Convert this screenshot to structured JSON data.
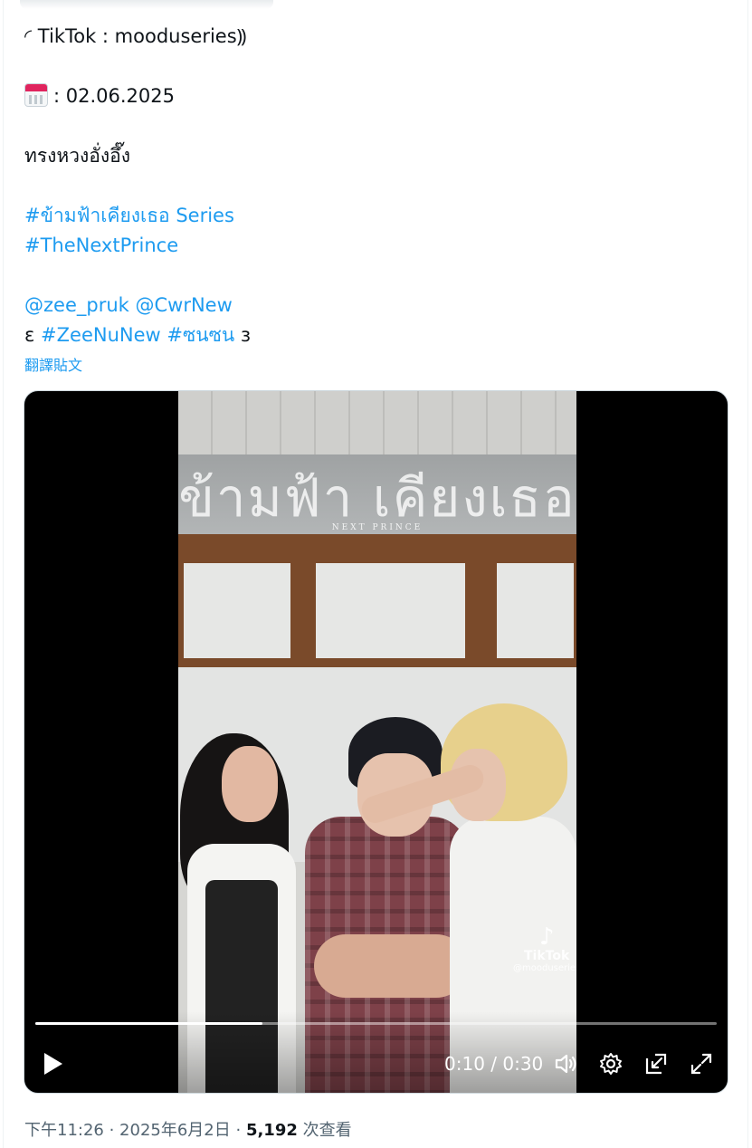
{
  "tweet": {
    "lines": {
      "line1": "◜ TikTok : mooduseries⸩",
      "date_value": ": 02.06.2025",
      "caption": "ทรงหวงอั่งอึ๊ง",
      "hashtag1": "#ข้ามฟ้าเคียงเธอ Series",
      "hashtag2": "#TheNextPrince",
      "mention1": "@zee_pruk",
      "mention2": "@CwrNew",
      "bracket_open": "ɛ",
      "hashtag3": "#ZeeNuNew",
      "hashtag4": "#ซนซน",
      "bracket_close": "з"
    },
    "calendar_icon": "calendar-icon",
    "translate_label": "翻譯貼文"
  },
  "video": {
    "overlay_title": "ข้ามฟ้า เคียงเธอ",
    "overlay_subtitle": "NEXT PRINCE",
    "watermark_brand": "TikTok",
    "watermark_user": "@mooduseries",
    "time_display": "0:10 / 0:30",
    "progress": 0.333,
    "icons": {
      "play": "play-icon",
      "volume": "volume-icon",
      "settings": "gear-icon",
      "pip": "picture-in-picture-icon",
      "fullscreen": "fullscreen-icon"
    }
  },
  "meta": {
    "time": "下午11:26",
    "separator": " · ",
    "date": "2025年6月2日",
    "views": "5,192",
    "views_label": " 次查看"
  }
}
